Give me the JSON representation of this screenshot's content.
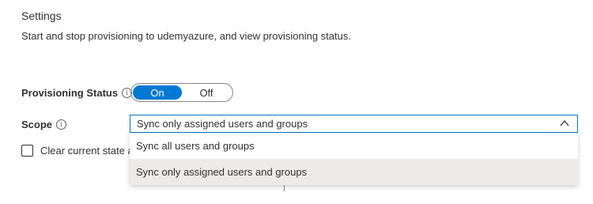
{
  "settings": {
    "title": "Settings",
    "description": "Start and stop provisioning to udemyazure, and view provisioning status."
  },
  "provisioning_status": {
    "label": "Provisioning Status",
    "on_label": "On",
    "off_label": "Off",
    "selected": "On",
    "accent_color": "#0078d4"
  },
  "scope": {
    "label": "Scope",
    "selected_value": "Sync only assigned users and groups",
    "options": [
      "Sync all users and groups",
      "Sync only assigned users and groups"
    ]
  },
  "clear_state": {
    "label": "Clear current state a",
    "checked": false
  },
  "icons": {
    "info": "info-icon",
    "chevron": "chevron-up-icon"
  }
}
